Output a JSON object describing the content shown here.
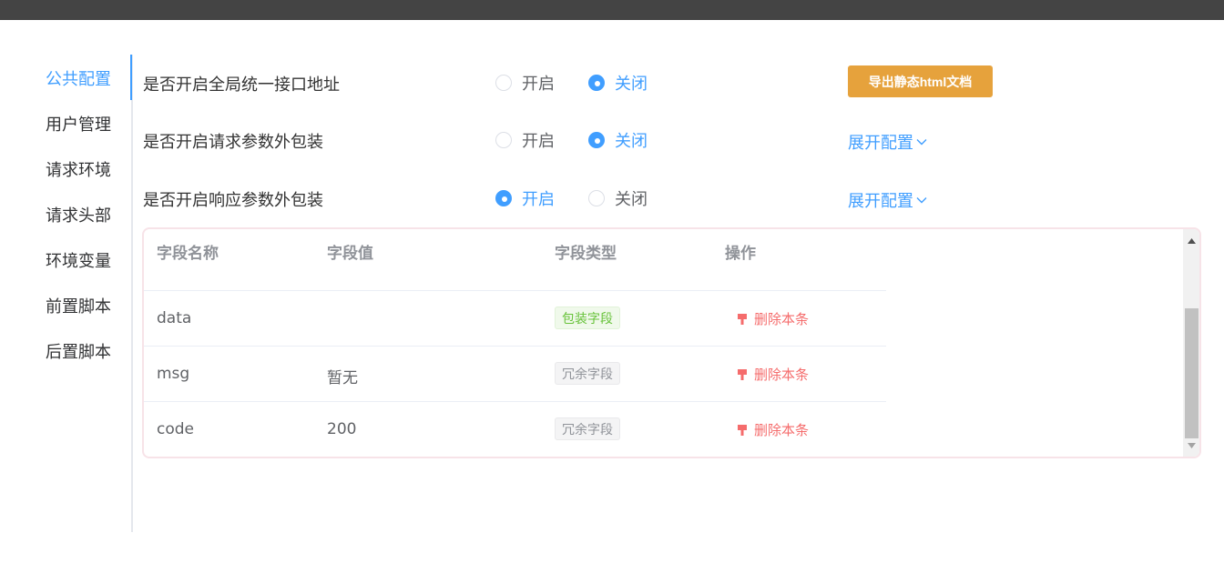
{
  "sidebar": {
    "items": [
      {
        "label": "公共配置",
        "active": true
      },
      {
        "label": "用户管理"
      },
      {
        "label": "请求环境"
      },
      {
        "label": "请求头部"
      },
      {
        "label": "环境变量"
      },
      {
        "label": "前置脚本"
      },
      {
        "label": "后置脚本"
      }
    ]
  },
  "settings": {
    "global_url": {
      "label": "是否开启全局统一接口地址",
      "on_label": "开启",
      "off_label": "关闭",
      "selected": "off"
    },
    "request_wrap": {
      "label": "是否开启请求参数外包装",
      "on_label": "开启",
      "off_label": "关闭",
      "selected": "off"
    },
    "response_wrap": {
      "label": "是否开启响应参数外包装",
      "on_label": "开启",
      "off_label": "关闭",
      "selected": "on"
    }
  },
  "export_button": "导出静态html文档",
  "expand_link": "展开配置",
  "table": {
    "headers": [
      "字段名称",
      "字段值",
      "字段类型",
      "操作"
    ],
    "rows": [
      {
        "name": "data",
        "value": "",
        "type": "包装字段",
        "type_style": "success",
        "action": "删除本条"
      },
      {
        "name": "msg",
        "value": "暂无",
        "type": "冗余字段",
        "type_style": "info",
        "action": "删除本条"
      },
      {
        "name": "code",
        "value": "200",
        "type": "冗余字段",
        "type_style": "info",
        "action": "删除本条"
      }
    ]
  },
  "colors": {
    "primary": "#409eff",
    "warning": "#e6a23c",
    "danger": "#f56c6c",
    "success": "#67c23a",
    "topbar": "#444444"
  }
}
